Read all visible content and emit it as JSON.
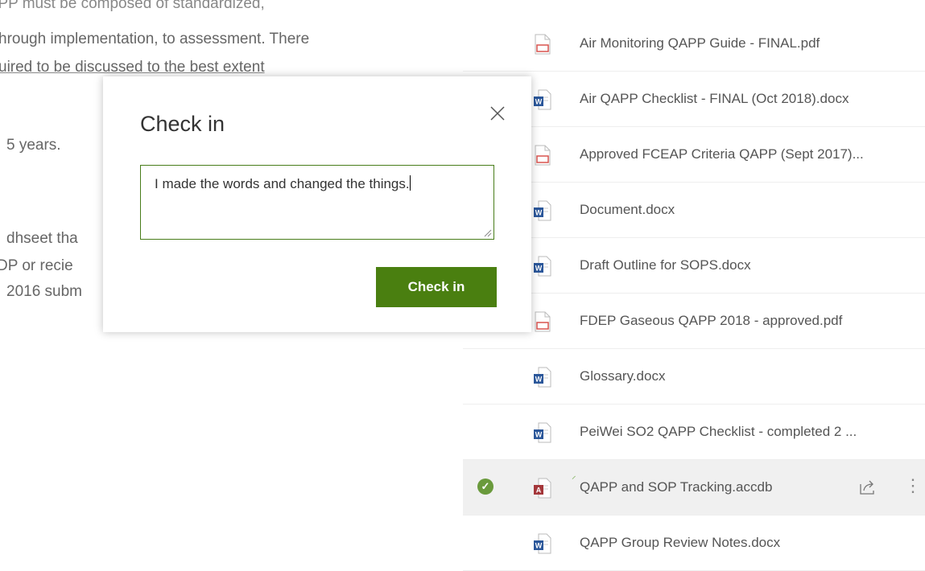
{
  "background_text": {
    "line1": "QAPP must be composed of standardized,",
    "line2": "hrough implementation, to assessment. There",
    "line3": "uired to be discussed to the best extent",
    "line4": "5 years.",
    "line5": "dhseet tha",
    "line6": "DP or recie",
    "line7": "2016 subm"
  },
  "files": [
    {
      "name": "Air Monitoring QAPP Guide - FINAL.pdf",
      "type": "pdf"
    },
    {
      "name": "Air QAPP Checklist - FINAL (Oct 2018).docx",
      "type": "word"
    },
    {
      "name": "Approved FCEAP Criteria QAPP (Sept 2017)...",
      "type": "pdf"
    },
    {
      "name": "Document.docx",
      "type": "word"
    },
    {
      "name": "Draft Outline for SOPS.docx",
      "type": "word"
    },
    {
      "name": "FDEP Gaseous QAPP 2018 - approved.pdf",
      "type": "pdf"
    },
    {
      "name": "Glossary.docx",
      "type": "word"
    },
    {
      "name": "PeiWei SO2 QAPP Checklist - completed 2 ...",
      "type": "word"
    },
    {
      "name": "QAPP and SOP Tracking.accdb",
      "type": "access"
    },
    {
      "name": "QAPP Group Review Notes.docx",
      "type": "word"
    }
  ],
  "dialog": {
    "title": "Check in",
    "comment_value": "I made the words and changed the things.",
    "button_label": "Check in"
  },
  "colors": {
    "accent_green": "#4a7f10",
    "pdf_red": "#d9534f",
    "word_blue": "#2b579a",
    "access_red": "#a4373a"
  }
}
